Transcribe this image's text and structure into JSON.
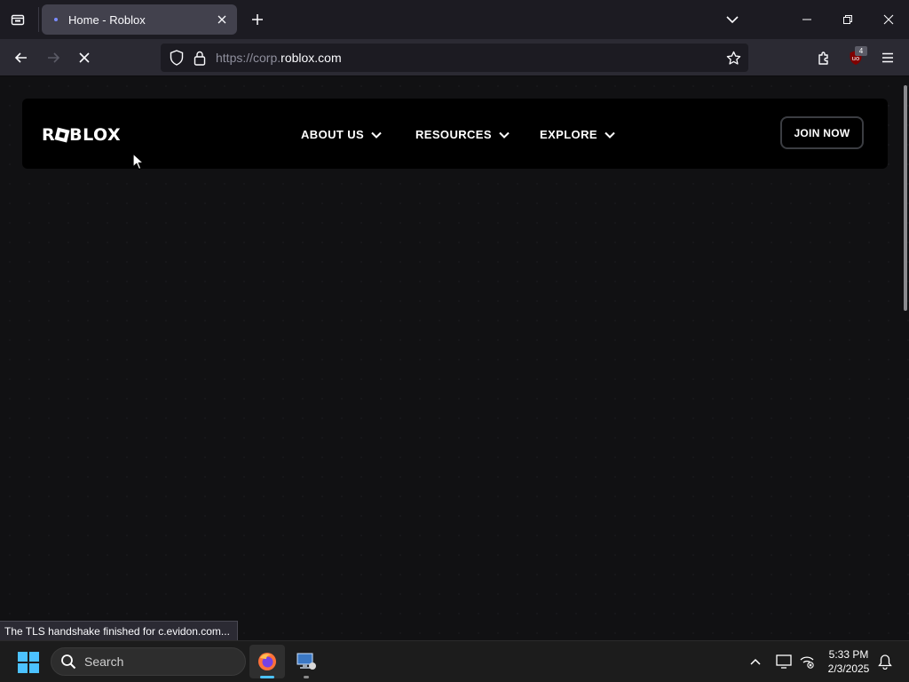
{
  "browser": {
    "tab": {
      "title": "Home - Roblox"
    },
    "url": {
      "prefix": "https://corp.",
      "domain": "roblox.com",
      "path": ""
    },
    "extension_badge": "4",
    "status_text": "The TLS handshake finished for c.evidon.com..."
  },
  "site": {
    "logo_text_1": "R",
    "logo_text_2": "BLOX",
    "nav": [
      {
        "label": "ABOUT US"
      },
      {
        "label": "RESOURCES"
      },
      {
        "label": "EXPLORE"
      }
    ],
    "cta_label": "JOIN NOW"
  },
  "taskbar": {
    "search_label": "Search",
    "time": "5:33 PM",
    "date": "2/3/2025"
  },
  "colors": {
    "accent": "#4cc2ff",
    "page_background": "#111113",
    "header_background": "#000000"
  }
}
